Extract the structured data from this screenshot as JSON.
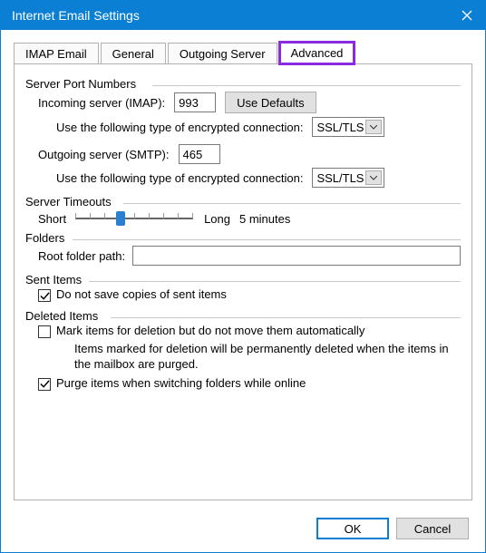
{
  "window": {
    "title": "Internet Email Settings"
  },
  "tabs": {
    "imap": "IMAP Email",
    "general": "General",
    "outgoing": "Outgoing Server",
    "advanced": "Advanced"
  },
  "serverPorts": {
    "groupLabel": "Server Port Numbers",
    "incomingLabel": "Incoming server (IMAP):",
    "incomingValue": "993",
    "useDefaultsLabel": "Use Defaults",
    "encTypeLabel": "Use the following type of encrypted connection:",
    "incomingEnc": "SSL/TLS",
    "outgoingLabel": "Outgoing server (SMTP):",
    "outgoingValue": "465",
    "outgoingEnc": "SSL/TLS"
  },
  "timeouts": {
    "groupLabel": "Server Timeouts",
    "shortLabel": "Short",
    "longLabel": "Long",
    "valueLabel": "5 minutes"
  },
  "folders": {
    "groupLabel": "Folders",
    "rootPathLabel": "Root folder path:",
    "rootPathValue": ""
  },
  "sentItems": {
    "groupLabel": "Sent Items",
    "doNotSave": "Do not save copies of sent items"
  },
  "deletedItems": {
    "groupLabel": "Deleted Items",
    "markForDeletion": "Mark items for deletion but do not move them automatically",
    "note": "Items marked for deletion will be permanently deleted when the items in the mailbox are purged.",
    "purge": "Purge items when switching folders while online"
  },
  "buttons": {
    "ok": "OK",
    "cancel": "Cancel"
  }
}
